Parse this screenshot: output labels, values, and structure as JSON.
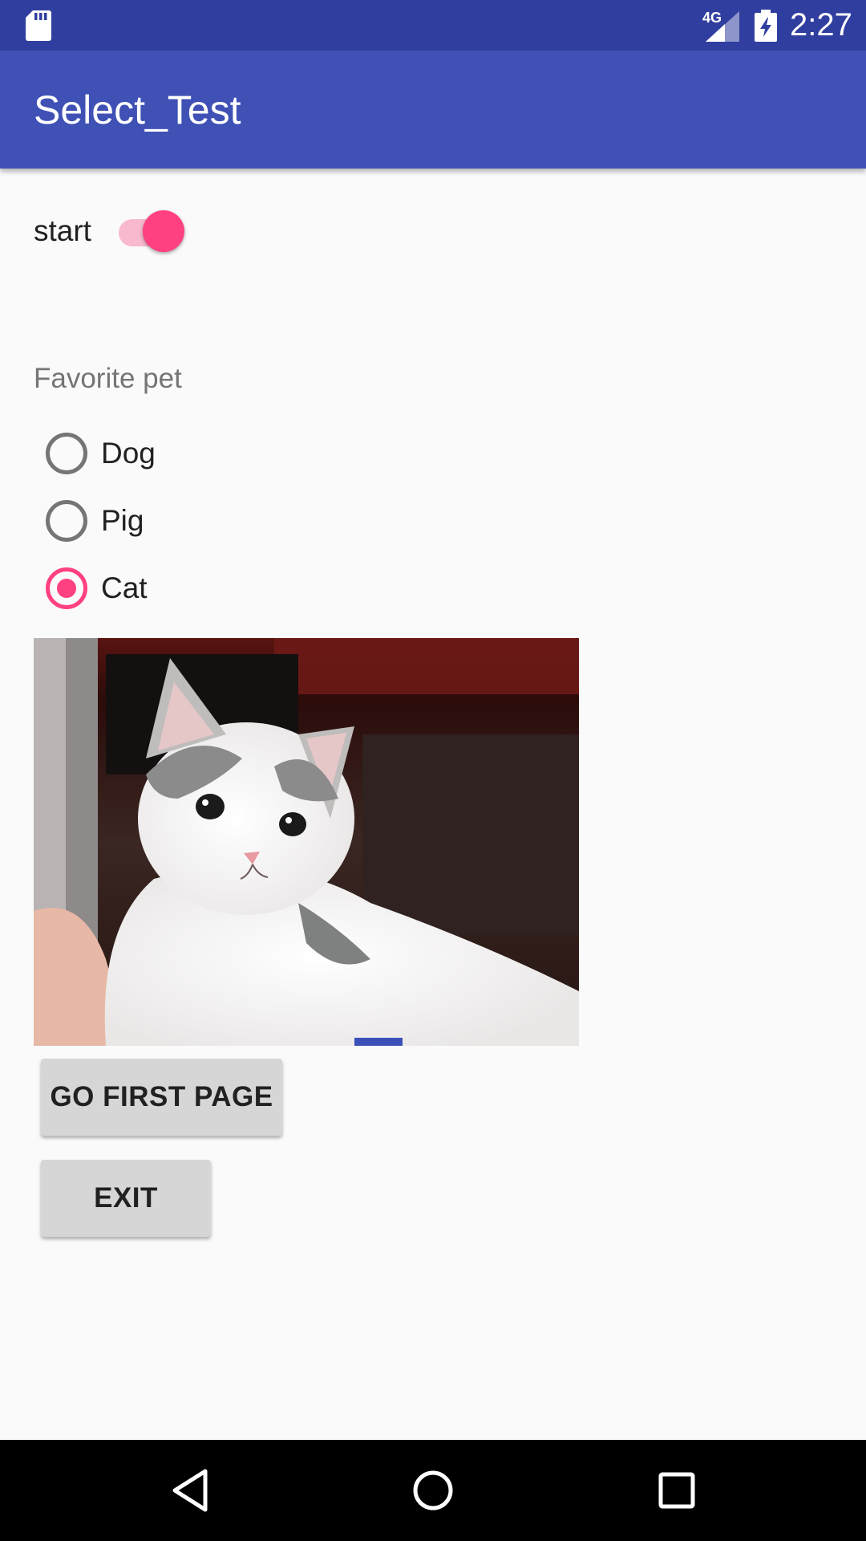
{
  "status_bar": {
    "time": "2:27",
    "network": "4G",
    "icons": [
      "sd-card-icon",
      "cell-signal-icon",
      "battery-charging-icon"
    ]
  },
  "app_bar": {
    "title": "Select_Test",
    "color": "#3f51b5"
  },
  "switch": {
    "label": "start",
    "checked": true,
    "accent_color": "#ff4081"
  },
  "radio_group": {
    "label": "Favorite pet",
    "options": [
      {
        "label": "Dog",
        "checked": false
      },
      {
        "label": "Pig",
        "checked": false
      },
      {
        "label": "Cat",
        "checked": true
      }
    ]
  },
  "image": {
    "subject": "white-and-grey kitten photo"
  },
  "buttons": {
    "go_first_page": "GO FIRST PAGE",
    "exit": "EXIT"
  },
  "nav_bar": {
    "icons": [
      "back-icon",
      "home-icon",
      "recents-icon"
    ]
  }
}
